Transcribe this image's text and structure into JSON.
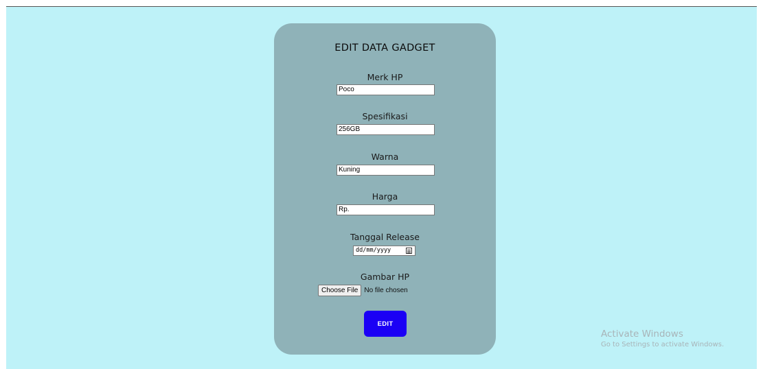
{
  "form": {
    "title": "EDIT DATA GADGET",
    "fields": [
      {
        "label": "Merk HP",
        "value": "Poco"
      },
      {
        "label": "Spesifikasi",
        "value": "256GB"
      },
      {
        "label": "Warna",
        "value": "Kuning"
      },
      {
        "label": "Harga",
        "value": "Rp."
      }
    ],
    "release": {
      "label": "Tanggal Release",
      "placeholder": "dd/mm/yyyy",
      "icon": "calendar-icon"
    },
    "image": {
      "label": "Gambar HP",
      "button_label": "Choose File",
      "status": "No file chosen"
    },
    "submit_label": "EDIT"
  },
  "watermark": {
    "title": "Activate Windows",
    "subtitle": "Go to Settings to activate Windows."
  },
  "colors": {
    "page_background": "#bef2f8",
    "card_background": "#8fb2b8",
    "submit_button": "#1b00f5"
  }
}
